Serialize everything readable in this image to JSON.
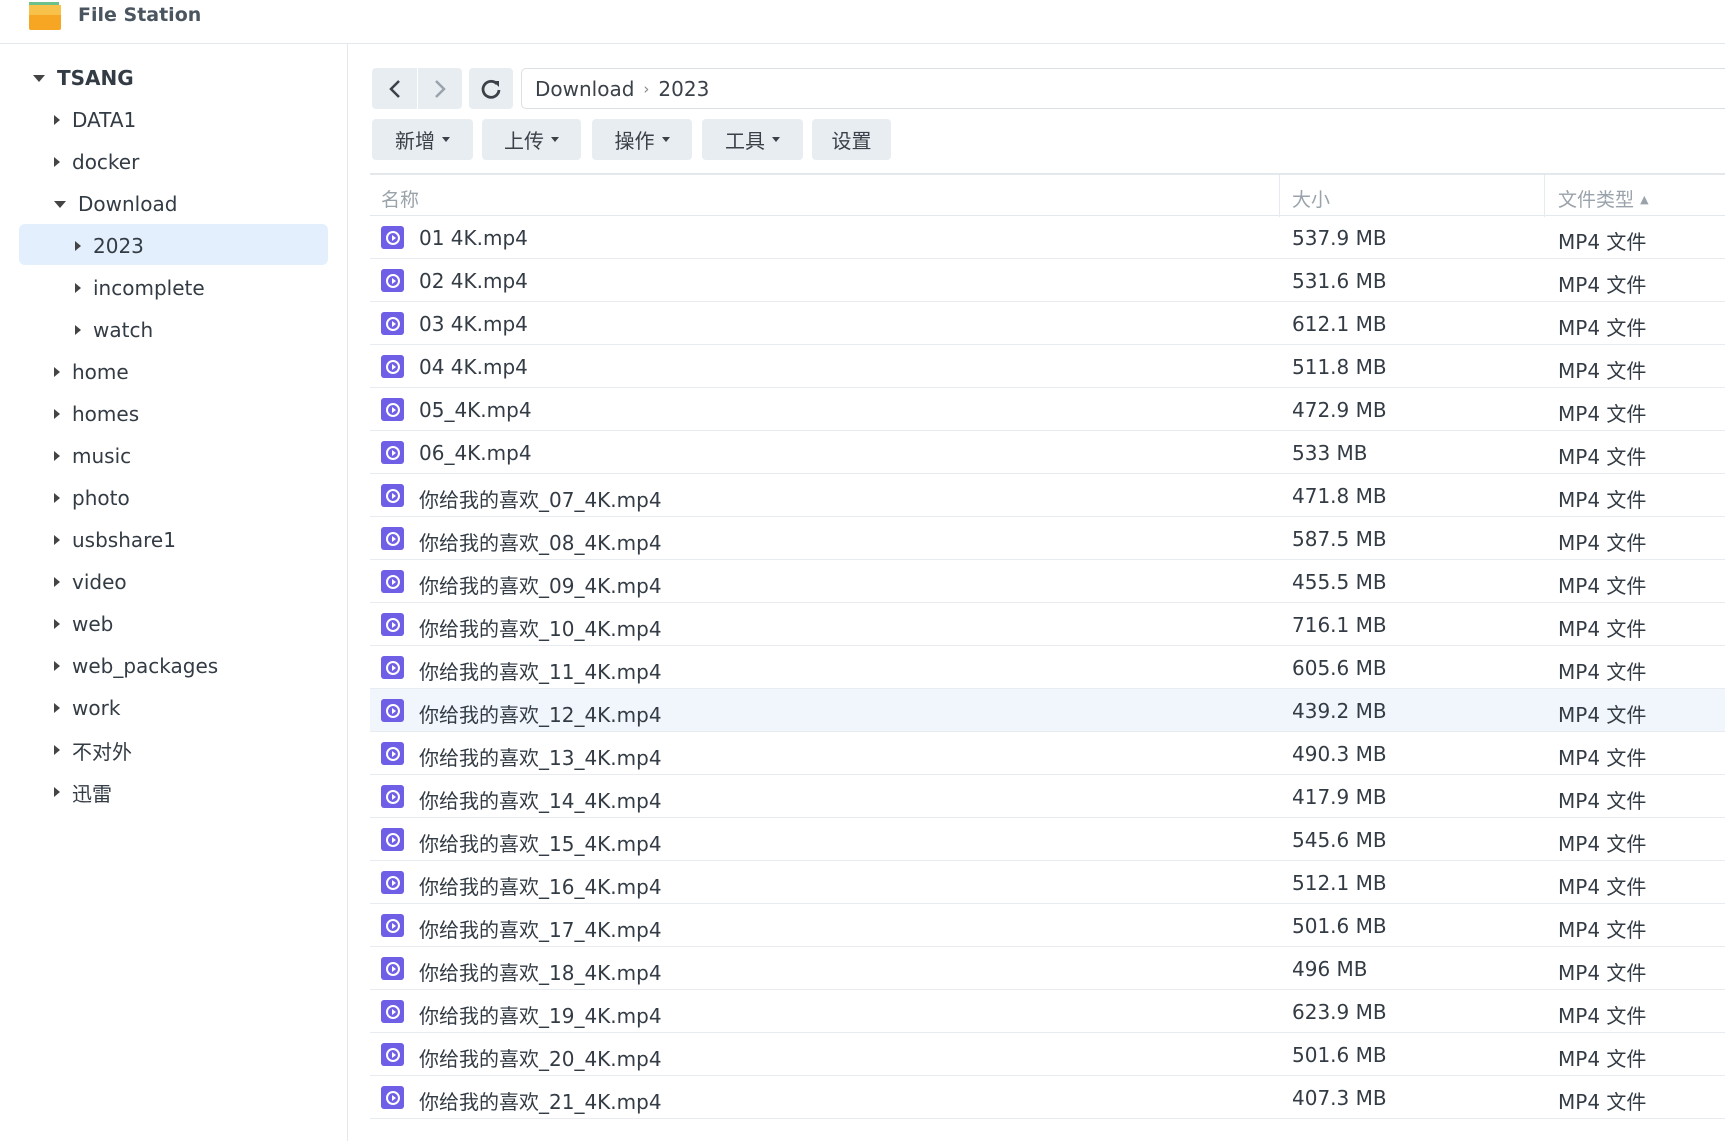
{
  "app": {
    "title": "File Station"
  },
  "sidebar": {
    "root": "TSANG",
    "items": [
      {
        "label": "DATA1",
        "level": 1,
        "expanded": false
      },
      {
        "label": "docker",
        "level": 1,
        "expanded": false
      },
      {
        "label": "Download",
        "level": 1,
        "expanded": true
      },
      {
        "label": "2023",
        "level": 2,
        "expanded": false,
        "selected": true
      },
      {
        "label": "incomplete",
        "level": 2,
        "expanded": false
      },
      {
        "label": "watch",
        "level": 2,
        "expanded": false
      },
      {
        "label": "home",
        "level": 1,
        "expanded": false
      },
      {
        "label": "homes",
        "level": 1,
        "expanded": false
      },
      {
        "label": "music",
        "level": 1,
        "expanded": false
      },
      {
        "label": "photo",
        "level": 1,
        "expanded": false
      },
      {
        "label": "usbshare1",
        "level": 1,
        "expanded": false
      },
      {
        "label": "video",
        "level": 1,
        "expanded": false
      },
      {
        "label": "web",
        "level": 1,
        "expanded": false
      },
      {
        "label": "web_packages",
        "level": 1,
        "expanded": false
      },
      {
        "label": "work",
        "level": 1,
        "expanded": false
      },
      {
        "label": "不对外",
        "level": 1,
        "expanded": false
      },
      {
        "label": "迅雷",
        "level": 1,
        "expanded": false
      }
    ]
  },
  "path": {
    "segments": [
      "Download",
      "2023"
    ]
  },
  "toolbar": {
    "create": "新增",
    "upload": "上传",
    "action": "操作",
    "tools": "工具",
    "settings": "设置"
  },
  "table": {
    "columns": {
      "name": "名称",
      "size": "大小",
      "type": "文件类型"
    },
    "rows": [
      {
        "name": "01 4K.mp4",
        "size": "537.9 MB",
        "type": "MP4 文件"
      },
      {
        "name": "02 4K.mp4",
        "size": "531.6 MB",
        "type": "MP4 文件"
      },
      {
        "name": "03 4K.mp4",
        "size": "612.1 MB",
        "type": "MP4 文件"
      },
      {
        "name": "04 4K.mp4",
        "size": "511.8 MB",
        "type": "MP4 文件"
      },
      {
        "name": "05_4K.mp4",
        "size": "472.9 MB",
        "type": "MP4 文件"
      },
      {
        "name": "06_4K.mp4",
        "size": "533 MB",
        "type": "MP4 文件"
      },
      {
        "name": "你给我的喜欢_07_4K.mp4",
        "size": "471.8 MB",
        "type": "MP4 文件"
      },
      {
        "name": "你给我的喜欢_08_4K.mp4",
        "size": "587.5 MB",
        "type": "MP4 文件"
      },
      {
        "name": "你给我的喜欢_09_4K.mp4",
        "size": "455.5 MB",
        "type": "MP4 文件"
      },
      {
        "name": "你给我的喜欢_10_4K.mp4",
        "size": "716.1 MB",
        "type": "MP4 文件"
      },
      {
        "name": "你给我的喜欢_11_4K.mp4",
        "size": "605.6 MB",
        "type": "MP4 文件"
      },
      {
        "name": "你给我的喜欢_12_4K.mp4",
        "size": "439.2 MB",
        "type": "MP4 文件",
        "hover": true
      },
      {
        "name": "你给我的喜欢_13_4K.mp4",
        "size": "490.3 MB",
        "type": "MP4 文件"
      },
      {
        "name": "你给我的喜欢_14_4K.mp4",
        "size": "417.9 MB",
        "type": "MP4 文件"
      },
      {
        "name": "你给我的喜欢_15_4K.mp4",
        "size": "545.6 MB",
        "type": "MP4 文件"
      },
      {
        "name": "你给我的喜欢_16_4K.mp4",
        "size": "512.1 MB",
        "type": "MP4 文件"
      },
      {
        "name": "你给我的喜欢_17_4K.mp4",
        "size": "501.6 MB",
        "type": "MP4 文件"
      },
      {
        "name": "你给我的喜欢_18_4K.mp4",
        "size": "496 MB",
        "type": "MP4 文件"
      },
      {
        "name": "你给我的喜欢_19_4K.mp4",
        "size": "623.9 MB",
        "type": "MP4 文件"
      },
      {
        "name": "你给我的喜欢_20_4K.mp4",
        "size": "501.6 MB",
        "type": "MP4 文件"
      },
      {
        "name": "你给我的喜欢_21_4K.mp4",
        "size": "407.3 MB",
        "type": "MP4 文件"
      }
    ]
  },
  "colors": {
    "accent": "#6f5ee6",
    "selected": "#e3effc"
  }
}
